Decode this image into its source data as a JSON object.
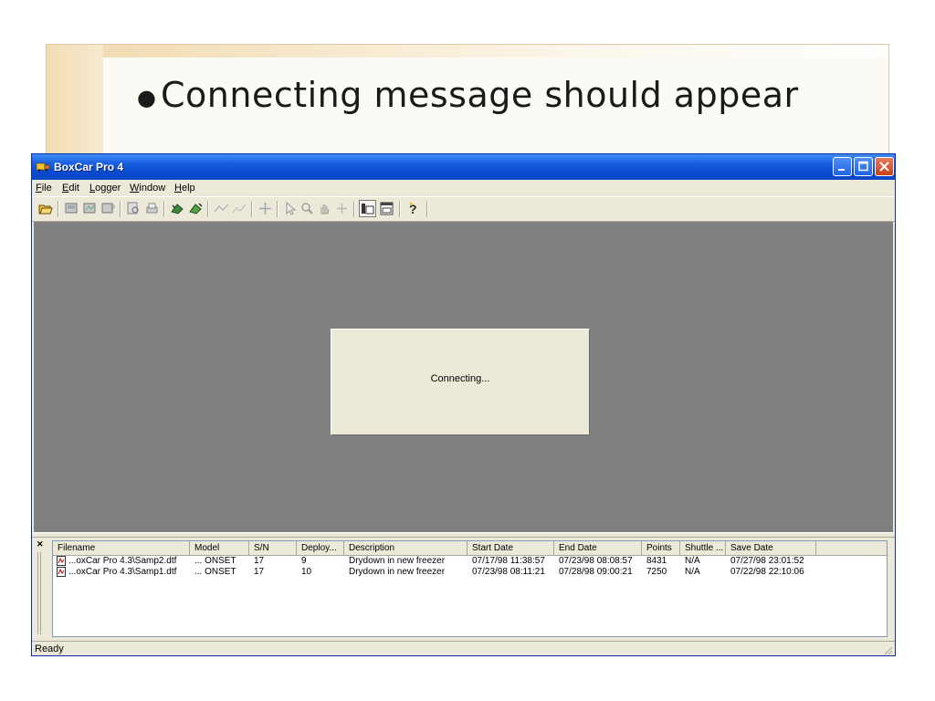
{
  "slide": {
    "bullet": "Connecting message should appear"
  },
  "window": {
    "title": "BoxCar Pro 4"
  },
  "menu": [
    {
      "label": "File",
      "access": "F",
      "rest": "ile"
    },
    {
      "label": "Edit",
      "access": "E",
      "rest": "dit"
    },
    {
      "label": "Logger",
      "access": "L",
      "rest": "ogger"
    },
    {
      "label": "Window",
      "access": "W",
      "rest": "indow"
    },
    {
      "label": "Help",
      "access": "H",
      "rest": "elp"
    }
  ],
  "toolbar": {
    "icons": [
      "open-icon",
      "logger-icon",
      "logger-readout-icon",
      "logger-status-icon",
      "zoom-preview-icon",
      "print-icon",
      "launch-icon",
      "readout-icon",
      "line-icon",
      "scatter-icon",
      "crosshair-icon",
      "pointer-icon",
      "zoom-icon",
      "pan-icon",
      "add-icon",
      "details-pane-icon",
      "tile-icon",
      "help-icon"
    ]
  },
  "dialog": {
    "message": "Connecting..."
  },
  "table": {
    "columns": [
      "Filename",
      "Model",
      "S/N",
      "Deploy...",
      "Description",
      "Start Date",
      "End Date",
      "Points",
      "Shuttle ...",
      "Save Date"
    ],
    "rows": [
      [
        "...oxCar Pro 4.3\\Samp2.dtf",
        "... ONSET",
        "17",
        "9",
        "Drydown in new freezer",
        "07/17/98 11:38:57",
        "07/23/98 08:08:57",
        "8431",
        "N/A",
        "07/27/98 23:01:52"
      ],
      [
        "...oxCar Pro 4.3\\Samp1.dtf",
        "... ONSET",
        "17",
        "10",
        "Drydown in new freezer",
        "07/23/98 08:11:21",
        "07/28/98 09:00:21",
        "7250",
        "N/A",
        "07/22/98 22:10:06"
      ]
    ]
  },
  "status": {
    "text": "Ready"
  },
  "colors": {
    "titlebar": "#0b47c4",
    "workspace": "#808080",
    "chrome": "#ece9d8",
    "close_button": "#c8421a"
  }
}
